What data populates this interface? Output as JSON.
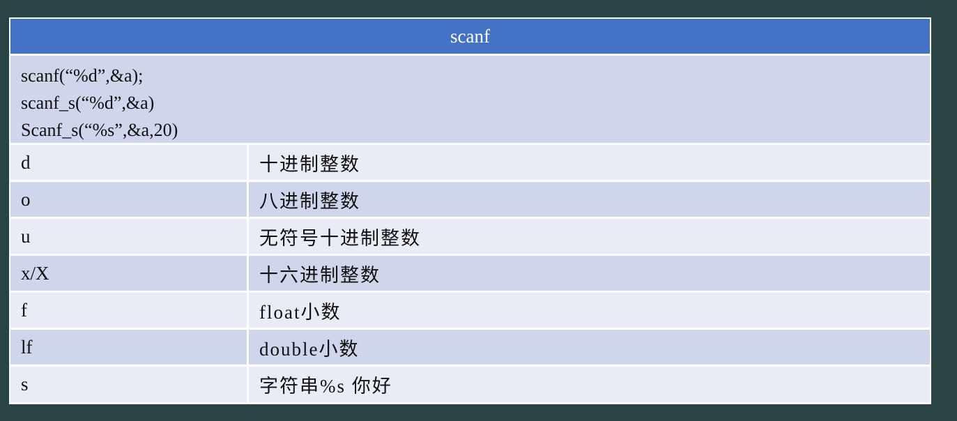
{
  "table": {
    "header": "scanf",
    "code_lines": [
      "scanf(“%d”,&a);",
      "scanf_s(“%d”,&a)",
      "Scanf_s(“%s”,&a,20)"
    ],
    "rows": [
      {
        "spec": "d",
        "desc": "十进制整数"
      },
      {
        "spec": "o",
        "desc": "八进制整数"
      },
      {
        "spec": "u",
        "desc": "无符号十进制整数"
      },
      {
        "spec": "x/X",
        "desc": "十六进制整数"
      },
      {
        "spec": "f",
        "desc": "float小数"
      },
      {
        "spec": "lf",
        "desc": "double小数"
      },
      {
        "spec": "s",
        "desc": "字符串%s 你好"
      }
    ]
  },
  "colors": {
    "background": "#2a4446",
    "header": "#4472c4",
    "row_dark": "#cfd5ea",
    "row_light": "#e9ebf5"
  }
}
